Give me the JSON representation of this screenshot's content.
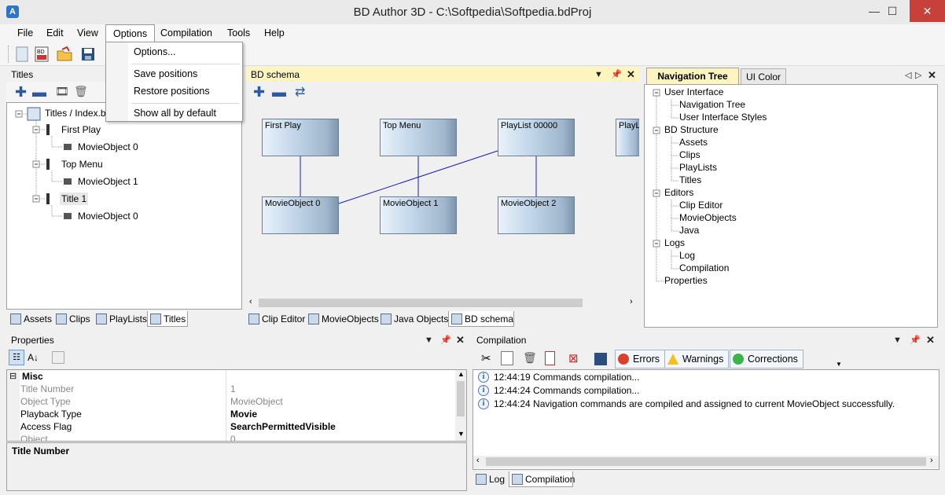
{
  "window": {
    "title": "BD Author 3D - C:\\Softpedia\\Softpedia.bdProj",
    "app_icon": "A",
    "minimize": "—",
    "maximize": "☐",
    "close": "✕"
  },
  "menu": [
    "File",
    "Edit",
    "View",
    "Options",
    "Compilation",
    "Tools",
    "Help"
  ],
  "options_menu": {
    "items": [
      "Options...",
      "Save positions",
      "Restore positions",
      "Show all by default"
    ]
  },
  "titles_panel": {
    "header": "Titles",
    "tree": [
      "Titles / Index.bdmv",
      "First Play",
      "MovieObject 0",
      "Top Menu",
      "MovieObject 1",
      "Title 1",
      "MovieObject 0"
    ],
    "tabs": [
      "Assets",
      "Clips",
      "PlayLists",
      "Titles"
    ]
  },
  "schema_panel": {
    "header": "BD schema",
    "nodes": [
      "First Play",
      "Top Menu",
      "PlayList 00000",
      "PlayList",
      "MovieObject 0",
      "MovieObject 1",
      "MovieObject 2"
    ],
    "tabs": [
      "Clip Editor",
      "MovieObjects",
      "Java Objects",
      "BD schema"
    ]
  },
  "nav_panel": {
    "tabs": [
      "Navigation Tree",
      "UI Color"
    ],
    "tree": {
      "user_interface": "User Interface",
      "navigation_tree": "Navigation Tree",
      "ui_styles": "User Interface Styles",
      "bd_structure": "BD Structure",
      "assets": "Assets",
      "clips": "Clips",
      "playlists": "PlayLists",
      "titles": "Titles",
      "editors": "Editors",
      "clip_editor": "Clip Editor",
      "movieobjects": "MovieObjects",
      "java": "Java",
      "logs": "Logs",
      "log": "Log",
      "compilation": "Compilation",
      "properties": "Properties"
    }
  },
  "properties_panel": {
    "header": "Properties",
    "category": "Misc",
    "rows": [
      {
        "name": "Title Number",
        "value": "1"
      },
      {
        "name": "Object Type",
        "value": "MovieObject"
      },
      {
        "name": "Playback Type",
        "value": "Movie"
      },
      {
        "name": "Access Flag",
        "value": "SearchPermittedVisible"
      },
      {
        "name": "Object",
        "value": "0"
      }
    ],
    "description_title": "Title Number"
  },
  "compilation_panel": {
    "header": "Compilation",
    "buttons": [
      "Errors",
      "Warnings",
      "Corrections"
    ],
    "log": [
      "12:44:19 Commands compilation...",
      "12:44:24 Commands compilation...",
      "12:44:24 Navigation commands are compiled and assigned to current MovieObject successfully."
    ],
    "tabs": [
      "Log",
      "Compilation"
    ]
  },
  "colors": {
    "accent_header": "#fdf4bf",
    "close_button": "#c7403a",
    "node_line": "#1a1ab8"
  }
}
